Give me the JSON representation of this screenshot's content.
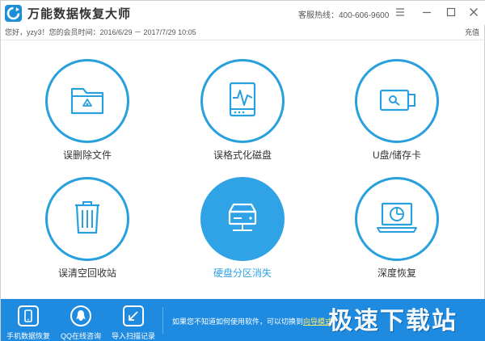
{
  "app": {
    "title": "万能数据恢复大师",
    "hotline": "客服热线：400-606-9600"
  },
  "info": {
    "member": "您好，yzy3！您的会员时间：2016/6/29 － 2017/7/29 10:05",
    "recharge": "充值"
  },
  "features": [
    {
      "label": "误删除文件",
      "icon": "folder-recycle-icon",
      "active": false
    },
    {
      "label": "误格式化磁盘",
      "icon": "disk-pulse-icon",
      "active": false
    },
    {
      "label": "U盘/储存卡",
      "icon": "usb-drive-icon",
      "active": false
    },
    {
      "label": "误清空回收站",
      "icon": "trash-bin-icon",
      "active": false
    },
    {
      "label": "硬盘分区消失",
      "icon": "hard-drive-network-icon",
      "active": true
    },
    {
      "label": "深度恢复",
      "icon": "laptop-scan-icon",
      "active": false
    }
  ],
  "bottom": {
    "items": [
      {
        "label": "手机数据恢复",
        "icon": "phone-icon"
      },
      {
        "label": "QQ在线咨询",
        "icon": "qq-penguin-icon"
      },
      {
        "label": "导入扫描记录",
        "icon": "import-icon"
      }
    ],
    "guide_text": "如果您不知道如何使用软件，可以切换到",
    "guide_link": "向导模式",
    "watermark": "极速下载站"
  },
  "colors": {
    "accent": "#29a0de",
    "active_fill": "#2fa3e6",
    "bottom_bar": "#1e8be0"
  }
}
